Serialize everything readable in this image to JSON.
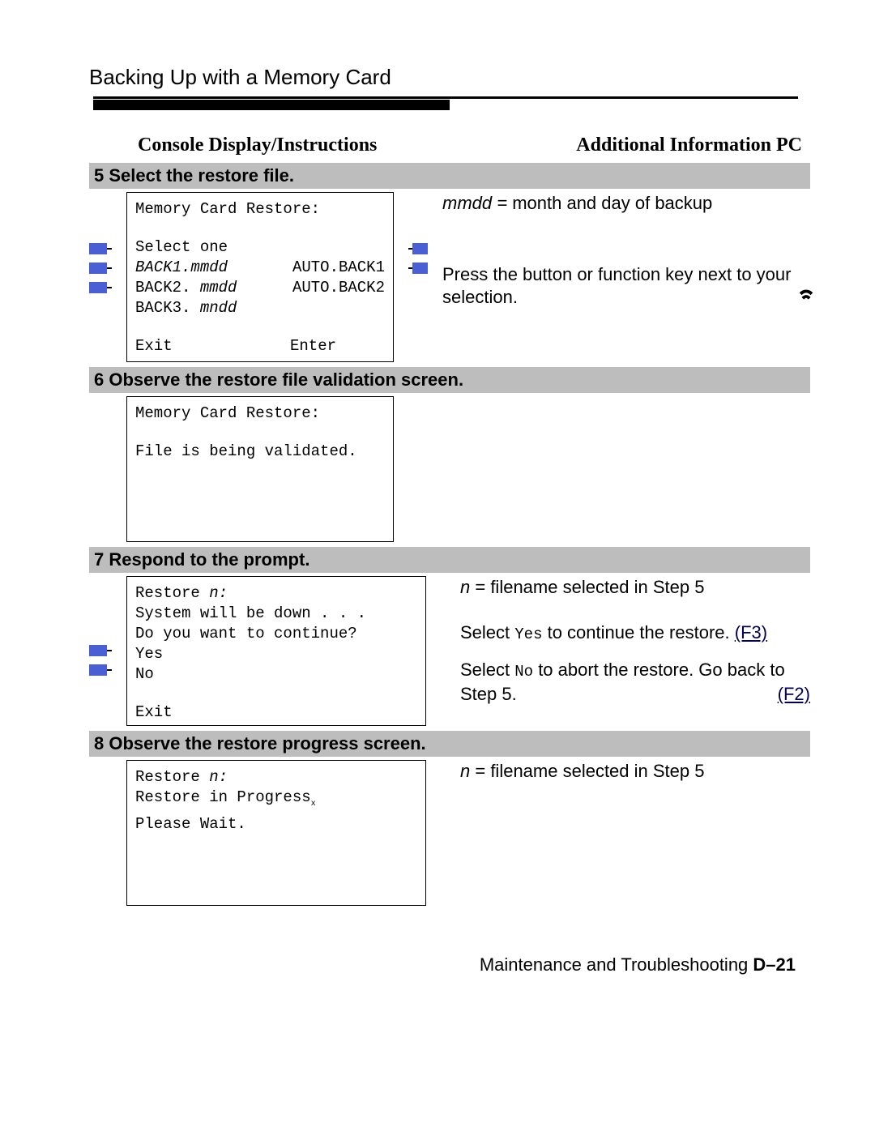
{
  "header": "Backing Up with a Memory Card",
  "colhead_left": "Console Display/Instructions",
  "colhead_right": "Additional Information PC",
  "step5": {
    "title": "5 Select the restore file.",
    "console": {
      "title": "Memory Card Restore:",
      "instr": "Select one",
      "r1a": "BACK1.",
      "r1ai": "mmdd",
      "r1b": "AUTO.BACK1",
      "r2a": "BACK2. ",
      "r2ai": "mmdd",
      "r2b": "AUTO.BACK2",
      "r3a": "BACK3. ",
      "r3ai": "mndd",
      "bl": "Exit",
      "br": "Enter"
    },
    "info1a": "mmdd =",
    "info1b": " month and day of backup",
    "info2": "Press the button or function key next to your selection."
  },
  "step6": {
    "title": "6 Observe the restore file validation screen.",
    "console": {
      "l1": "Memory Card Restore:",
      "l2": "File is being validated."
    }
  },
  "step7": {
    "title": "7 Respond to the prompt.",
    "console": {
      "l1a": "Restore ",
      "l1b": "n:",
      "l2": "System will be down . . .",
      "l3": "Do you want to continue?",
      "l4": "Yes",
      "l5": "No",
      "bl": "Exit"
    },
    "info1a": "n",
    "info1b": " = filename selected in Step 5",
    "info2a": "Select ",
    "info2b": "Yes",
    "info2c": " to continue the restore. ",
    "info2d": "(F3)",
    "info3a": "Select ",
    "info3b": "No",
    "info3c": " to abort the restore. Go back to Step 5.",
    "info3d": "(F2)"
  },
  "step8": {
    "title": "8 Observe the restore progress screen.",
    "console": {
      "l1a": "Restore ",
      "l1b": "n:",
      "l2": "Restore in Progress",
      "l3": "Please Wait."
    },
    "info1a": "n",
    "info1b": " = filename selected in Step 5"
  },
  "footer_a": "Maintenance and Troubleshooting ",
  "footer_b": "D–21"
}
